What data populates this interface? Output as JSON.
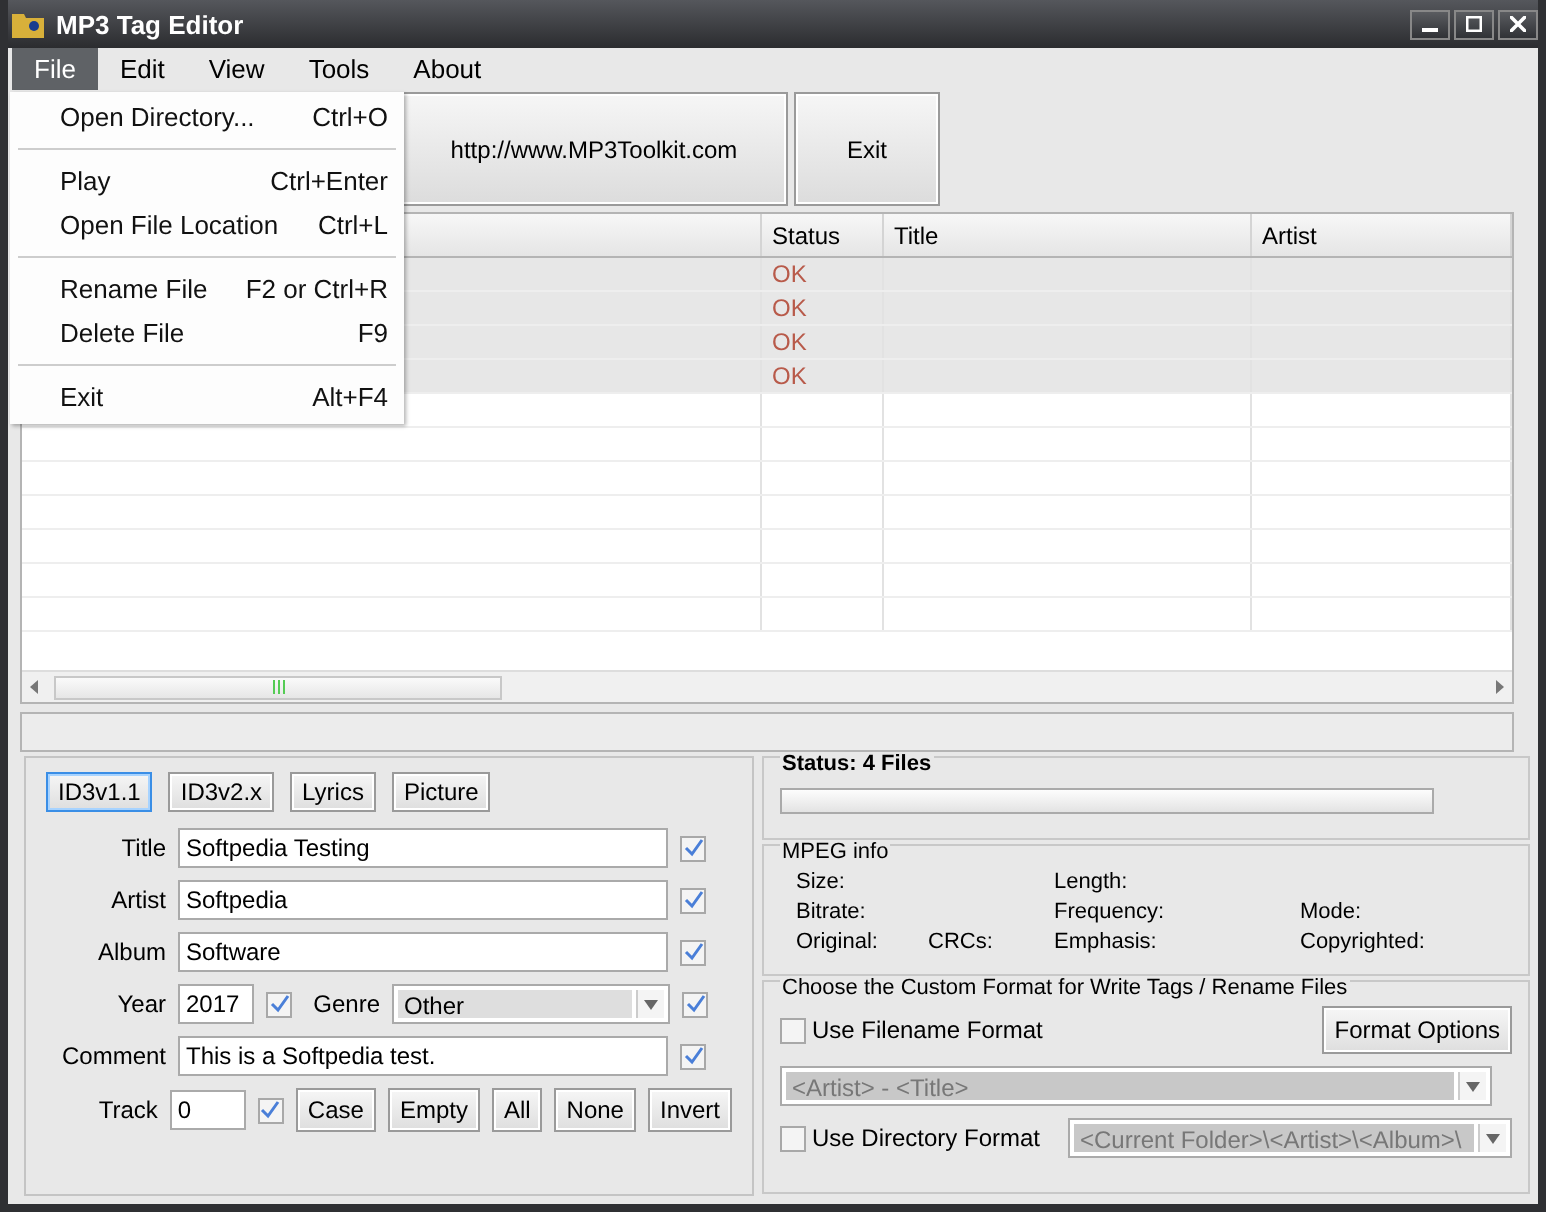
{
  "window": {
    "title": "MP3 Tag Editor"
  },
  "menu_bar": [
    {
      "label": "File",
      "selected": true
    },
    {
      "label": "Edit",
      "selected": false
    },
    {
      "label": "View",
      "selected": false
    },
    {
      "label": "Tools",
      "selected": false
    },
    {
      "label": "About",
      "selected": false
    }
  ],
  "file_menu": [
    {
      "kind": "item",
      "label": "Open Directory...",
      "shortcut": "Ctrl+O"
    },
    {
      "kind": "separator"
    },
    {
      "kind": "item",
      "label": "Play",
      "shortcut": "Ctrl+Enter"
    },
    {
      "kind": "item",
      "label": "Open File Location",
      "shortcut": "Ctrl+L"
    },
    {
      "kind": "separator"
    },
    {
      "kind": "item",
      "label": "Rename File",
      "shortcut": "F2 or Ctrl+R"
    },
    {
      "kind": "item",
      "label": "Delete File",
      "shortcut": "F9"
    },
    {
      "kind": "separator"
    },
    {
      "kind": "item",
      "label": "Exit",
      "shortcut": "Alt+F4"
    }
  ],
  "toolbar": [
    {
      "label": "http://www.MP3Toolkit.com"
    },
    {
      "label": "Exit"
    }
  ],
  "table": {
    "columns": [
      "Status",
      "Title",
      "Artist"
    ],
    "rows": [
      {
        "status": "OK"
      },
      {
        "status": "OK"
      },
      {
        "status": "OK"
      },
      {
        "status": "OK"
      }
    ]
  },
  "tag_tabs": [
    {
      "label": "ID3v1.1",
      "selected": true
    },
    {
      "label": "ID3v2.x",
      "selected": false
    },
    {
      "label": "Lyrics",
      "selected": false
    },
    {
      "label": "Picture",
      "selected": false
    }
  ],
  "tag_rows": [
    {
      "kind": "text",
      "label": "Title",
      "value": "Softpedia Testing",
      "checked": true
    },
    {
      "kind": "text",
      "label": "Artist",
      "value": "Softpedia",
      "checked": true
    },
    {
      "kind": "text",
      "label": "Album",
      "value": "Software",
      "checked": true
    },
    {
      "kind": "year_genre",
      "label": "Year",
      "value": "2017",
      "checked": true,
      "genre_label": "Genre",
      "genre": "Other",
      "genre_checked": true
    },
    {
      "kind": "text",
      "label": "Comment",
      "value": "This is a Softpedia test.",
      "checked": true
    },
    {
      "kind": "track",
      "label": "Track",
      "value": "0",
      "checked": true,
      "buttons": [
        "Case",
        "Empty",
        "All",
        "None",
        "Invert"
      ]
    }
  ],
  "status": {
    "label": "Status: 4 Files",
    "level": 0
  },
  "mpeg_info": {
    "title": "MPEG info",
    "rows": [
      [
        "Size:",
        null,
        "Length:",
        null
      ],
      [
        "Bitrate:",
        null,
        "Frequency:",
        "Mode:"
      ],
      [
        "Original:",
        "CRCs:",
        "Emphasis:",
        "Copyrighted:"
      ]
    ]
  },
  "custom_format": {
    "title": "Choose the Custom Format for Write Tags / Rename Files",
    "filename_option": {
      "label": "Use Filename Format",
      "checked": false
    },
    "format_options_button": "Format Options",
    "filename_format": "<Artist> - <Title>",
    "directory_option": {
      "label": "Use Directory Format",
      "checked": false
    },
    "directory_format": "<Current Folder>\\<Artist>\\<Album>\\"
  }
}
